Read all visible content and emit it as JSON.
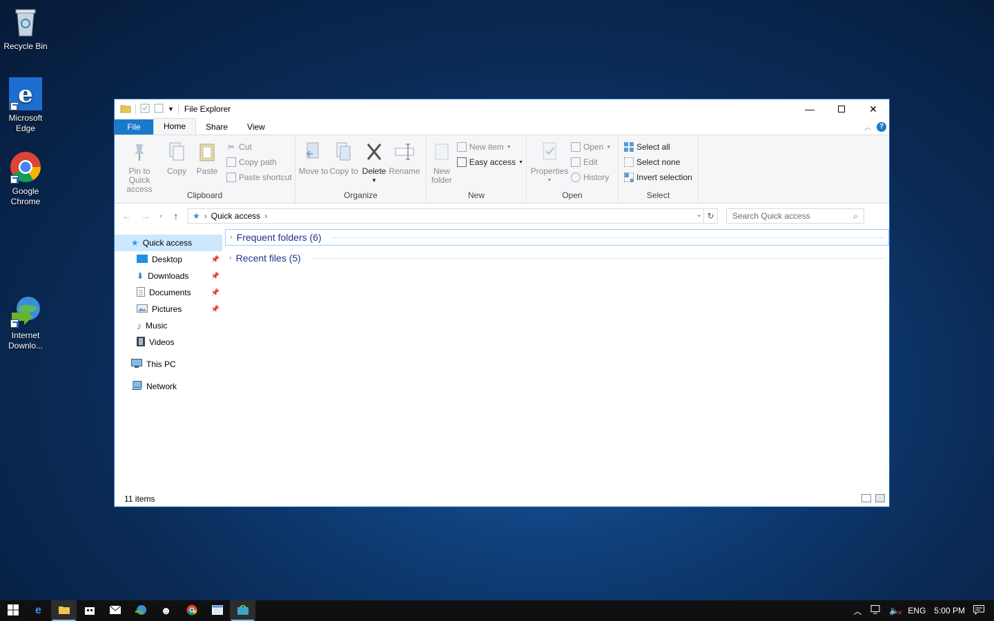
{
  "desktop": {
    "icons": [
      {
        "label": "Recycle Bin"
      },
      {
        "label": "Microsoft Edge"
      },
      {
        "label": "Google Chrome"
      },
      {
        "label": "Internet Downlo..."
      }
    ]
  },
  "window": {
    "title": "File Explorer",
    "tabs": {
      "file": "File",
      "home": "Home",
      "share": "Share",
      "view": "View"
    },
    "help": "?",
    "ribbon": {
      "clipboard": {
        "label": "Clipboard",
        "pin": "Pin to Quick access",
        "copy": "Copy",
        "paste": "Paste",
        "cut": "Cut",
        "copy_path": "Copy path",
        "paste_shortcut": "Paste shortcut"
      },
      "organize": {
        "label": "Organize",
        "move_to": "Move to",
        "copy_to": "Copy to",
        "delete": "Delete",
        "rename": "Rename"
      },
      "new": {
        "label": "New",
        "new_folder": "New folder",
        "new_item": "New item",
        "easy_access": "Easy access"
      },
      "open": {
        "label": "Open",
        "properties": "Properties",
        "open": "Open",
        "edit": "Edit",
        "history": "History"
      },
      "select": {
        "label": "Select",
        "select_all": "Select all",
        "select_none": "Select none",
        "invert": "Invert selection"
      }
    },
    "address": {
      "location": "Quick access"
    },
    "search": {
      "placeholder": "Search Quick access"
    },
    "nav": {
      "quick_access": "Quick access",
      "items": [
        "Desktop",
        "Downloads",
        "Documents",
        "Pictures",
        "Music",
        "Videos"
      ],
      "this_pc": "This PC",
      "network": "Network"
    },
    "sections": {
      "frequent": "Frequent folders (6)",
      "recent": "Recent files (5)"
    },
    "status": "11 items"
  },
  "taskbar": {
    "lang": "ENG",
    "time": "5:00 PM"
  },
  "colors": {
    "accent": "#1979ca",
    "selection": "#cce8ff",
    "section_text": "#1e3287"
  }
}
